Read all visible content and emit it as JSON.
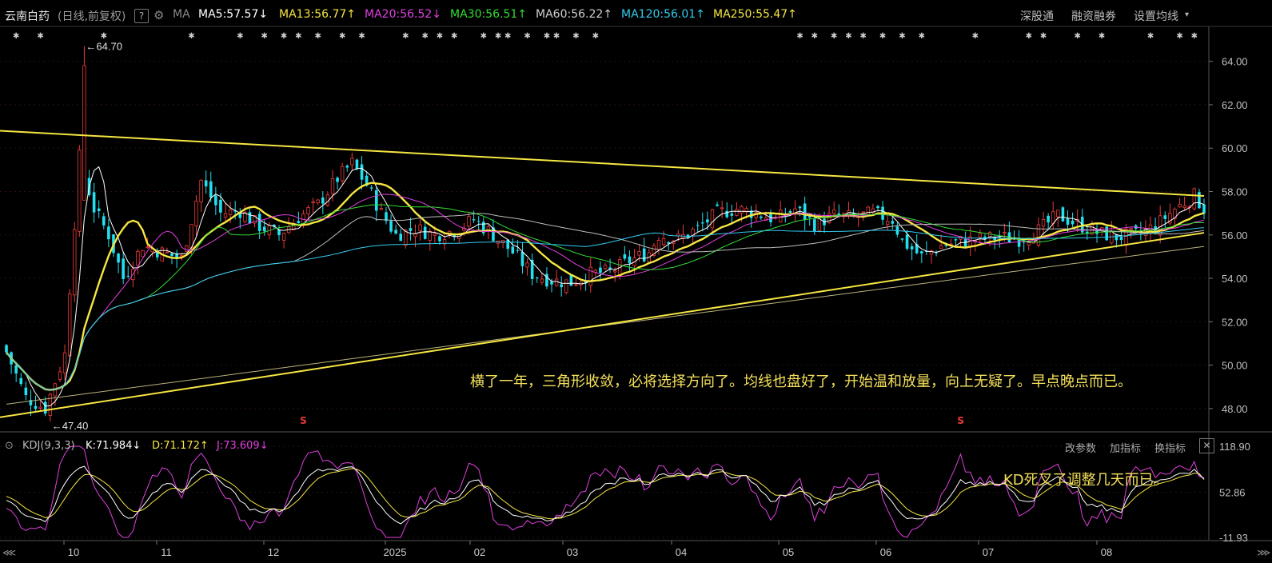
{
  "header": {
    "title": "云南白药",
    "subtitle": "(日线,前复权)",
    "help": "?",
    "ma_label": "MA",
    "indicators": [
      {
        "text": "MA5:57.57↓",
        "color": "#ffffff"
      },
      {
        "text": "MA13:56.77↑",
        "color": "#f5e642"
      },
      {
        "text": "MA20:56.52↓",
        "color": "#e040e0"
      },
      {
        "text": "MA30:56.51↑",
        "color": "#33dd33"
      },
      {
        "text": "MA60:56.22↑",
        "color": "#d0d0d0"
      },
      {
        "text": "MA120:56.01↑",
        "color": "#33ccee"
      },
      {
        "text": "MA250:55.47↑",
        "color": "#f5e642"
      }
    ],
    "links": [
      "深股通",
      "融资融券",
      "设置均线"
    ]
  },
  "sub": {
    "name": "KDJ(9,3,3)",
    "k": "K:71.984↓",
    "d": "D:71.172↑",
    "j": "J:73.609↓",
    "links": [
      "改参数",
      "加指标",
      "换指标"
    ],
    "close": "✕"
  },
  "annotations": {
    "main_note": "横了一年，三角形收敛，必将选择方向了。均线也盘好了，开始温和放量，向上无疑了。早点晚点而已。",
    "kdj_note": "KD死叉了调整几天而已。",
    "high_mark": "←64.70",
    "low_mark": "←47.40",
    "s_mark": "S"
  },
  "colors": {
    "up": "#ee3a3a",
    "down": "#22e0f0",
    "ma5": "#ffffff",
    "ma13": "#f5e642",
    "ma20": "#e040e0",
    "ma30": "#33dd33",
    "ma60": "#bbbbbb",
    "ma120": "#33ccee",
    "ma250": "#f5e642",
    "trend": "#f5e642"
  },
  "chart_data": [
    {
      "type": "candlestick",
      "title": "云南白药 (日线,前复权)",
      "x_tick_labels": [
        "10",
        "11",
        "12",
        "2025",
        "02",
        "03",
        "04",
        "05",
        "06",
        "07",
        "08"
      ],
      "y_ticks": [
        48.0,
        50.0,
        52.0,
        54.0,
        56.0,
        58.0,
        60.0,
        62.0,
        64.0
      ],
      "ylim": [
        47.0,
        65.5
      ],
      "high": 64.7,
      "low": 47.4,
      "close_path": [
        [
          0,
          50.6
        ],
        [
          4,
          48.5
        ],
        [
          8,
          48.0
        ],
        [
          12,
          50.5
        ],
        [
          15,
          59.6
        ],
        [
          18,
          57.2
        ],
        [
          21,
          56.0
        ],
        [
          24,
          54.0
        ],
        [
          28,
          55.5
        ],
        [
          32,
          55.2
        ],
        [
          36,
          54.9
        ],
        [
          40,
          58.5
        ],
        [
          44,
          57.0
        ],
        [
          48,
          57.1
        ],
        [
          52,
          56.4
        ],
        [
          56,
          56.0
        ],
        [
          60,
          56.8
        ],
        [
          64,
          57.4
        ],
        [
          68,
          58.6
        ],
        [
          71,
          59.3
        ],
        [
          74,
          58.3
        ],
        [
          77,
          57.0
        ],
        [
          80,
          56.0
        ],
        [
          84,
          56.3
        ],
        [
          88,
          56.0
        ],
        [
          92,
          56.2
        ],
        [
          96,
          56.7
        ],
        [
          100,
          56.0
        ],
        [
          104,
          55.2
        ],
        [
          108,
          54.2
        ],
        [
          112,
          53.9
        ],
        [
          116,
          53.8
        ],
        [
          120,
          54.2
        ],
        [
          124,
          54.3
        ],
        [
          128,
          54.8
        ],
        [
          132,
          55.2
        ],
        [
          134,
          56.0
        ],
        [
          138,
          55.8
        ],
        [
          142,
          56.3
        ],
        [
          146,
          57.0
        ],
        [
          150,
          57.2
        ],
        [
          154,
          57.0
        ],
        [
          158,
          56.7
        ],
        [
          162,
          57.2
        ],
        [
          166,
          56.5
        ],
        [
          170,
          56.9
        ],
        [
          174,
          56.8
        ],
        [
          178,
          57.0
        ],
        [
          182,
          56.7
        ],
        [
          184,
          55.7
        ],
        [
          188,
          55.0
        ],
        [
          192,
          55.5
        ],
        [
          196,
          55.7
        ],
        [
          200,
          55.8
        ],
        [
          204,
          55.9
        ],
        [
          208,
          55.8
        ],
        [
          212,
          56.2
        ],
        [
          216,
          56.9
        ],
        [
          220,
          56.5
        ],
        [
          224,
          56.1
        ],
        [
          228,
          55.9
        ],
        [
          232,
          56.0
        ],
        [
          236,
          56.4
        ],
        [
          240,
          57.2
        ],
        [
          244,
          57.8
        ],
        [
          246,
          57.2
        ]
      ],
      "moving_averages": [
        {
          "name": "MA5",
          "value": 57.57
        },
        {
          "name": "MA13",
          "value": 56.77
        },
        {
          "name": "MA20",
          "value": 56.52
        },
        {
          "name": "MA30",
          "value": 56.51
        },
        {
          "name": "MA60",
          "value": 56.22
        },
        {
          "name": "MA120",
          "value": 56.01
        },
        {
          "name": "MA250",
          "value": 55.47
        }
      ],
      "trendlines": [
        {
          "from": [
            0,
            60.8
          ],
          "to": [
            246,
            57.8
          ]
        },
        {
          "from": [
            0,
            47.6
          ],
          "to": [
            246,
            56.1
          ]
        }
      ]
    },
    {
      "type": "line",
      "title": "KDJ(9,3,3)",
      "y_ticks": [
        118.9,
        52.86,
        -11.93
      ],
      "ylim": [
        -11.93,
        118.9
      ],
      "series": [
        {
          "name": "K",
          "last": 71.984
        },
        {
          "name": "D",
          "last": 71.172
        },
        {
          "name": "J",
          "last": 73.609
        }
      ]
    }
  ]
}
